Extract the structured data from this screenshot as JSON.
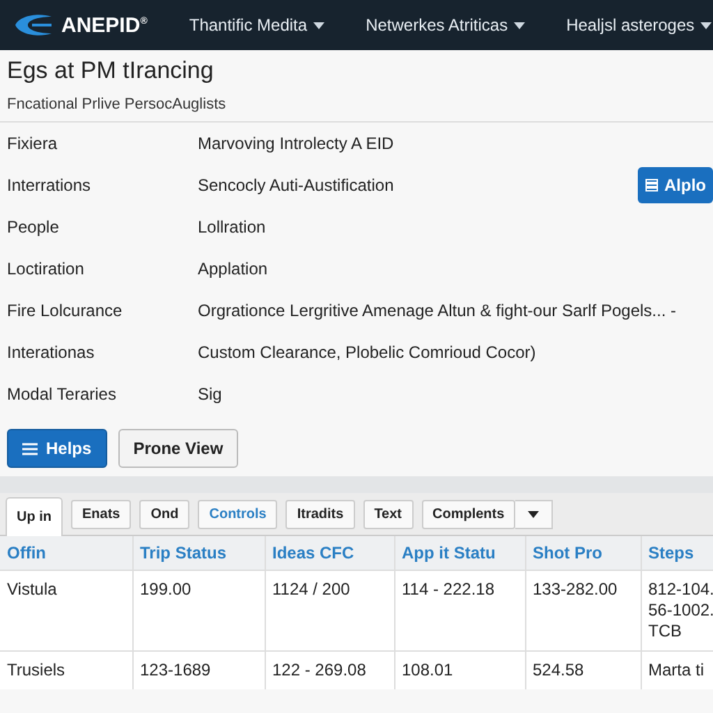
{
  "navbar": {
    "logo": "ANEPID",
    "logo_mark": "®",
    "menus": [
      {
        "label": "Thantific Medita"
      },
      {
        "label": "Netwerkes Atriticas"
      },
      {
        "label": "Healjsl asteroges"
      }
    ]
  },
  "page": {
    "title": "Egs at PM tIrancing",
    "subtitle": "Fncational Prlive PersocAuglists"
  },
  "details": [
    {
      "label": "Fixiera",
      "value": "Marvoving Introlecty A EID"
    },
    {
      "label": "Interrations",
      "value": "Sencocly Auti-Austification",
      "action": "Alplo"
    },
    {
      "label": "People",
      "value": "Lollration"
    },
    {
      "label": "Loctiration",
      "value": "Applation"
    },
    {
      "label": "Fire Lolcurance",
      "value": "Orgrationce Lergritive Amenage Altun & fight-our Sarlf Pogels... -"
    },
    {
      "label": "Interationas",
      "value": "Custom Clearance, Plobelic Comrioud Cocor)"
    },
    {
      "label": "Modal Teraries",
      "value": "Sig"
    }
  ],
  "buttons": [
    {
      "label": "Helps",
      "kind": "primary"
    },
    {
      "label": "Prone View",
      "kind": "secondary"
    }
  ],
  "tabs": [
    {
      "label": "Up in",
      "selected": true,
      "kind": "tab",
      "dropdown": false
    },
    {
      "label": "Enats",
      "selected": false,
      "kind": "tab",
      "dropdown": false
    },
    {
      "label": "Ond",
      "selected": false,
      "kind": "tab",
      "dropdown": false
    },
    {
      "label": "Controls",
      "selected": false,
      "kind": "link",
      "dropdown": false
    },
    {
      "label": "Itradits",
      "selected": false,
      "kind": "tab",
      "dropdown": false
    },
    {
      "label": "Text",
      "selected": false,
      "kind": "tab",
      "dropdown": false
    },
    {
      "label": "Complents",
      "selected": false,
      "kind": "tab",
      "dropdown": true
    }
  ],
  "table": {
    "columns": [
      "Offin",
      "Trip Status",
      "Ideas CFC",
      "App it Statu",
      "Shot Pro",
      "Steps"
    ],
    "rows": [
      [
        "Vistula",
        "199.00",
        "1124 / 200",
        "114 - 222.18",
        "133-282.00",
        "812-104.\n56-1002.\nTCB"
      ],
      [
        "Trusiels",
        "123-1689",
        "122 - 269.08",
        "108.01",
        "524.58",
        "Marta ti"
      ]
    ]
  }
}
